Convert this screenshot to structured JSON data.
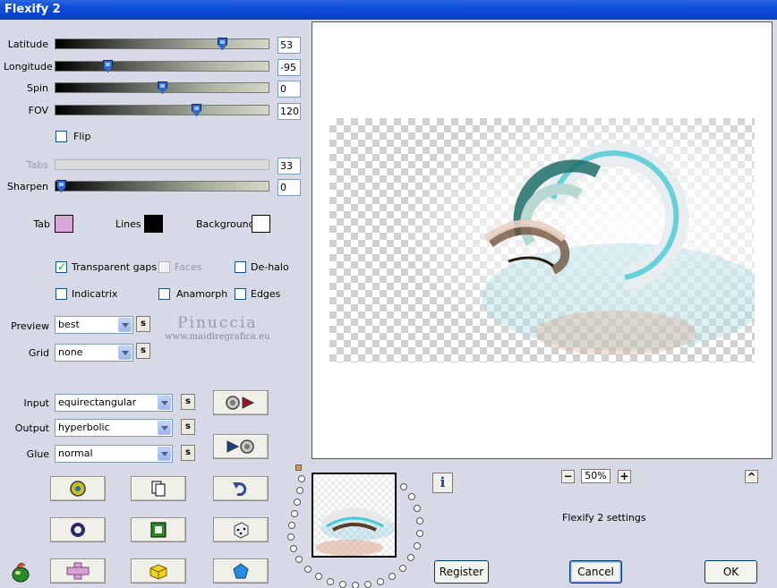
{
  "window": {
    "title": "Flexify 2"
  },
  "sliders": {
    "latitude": {
      "label": "Latitude",
      "value": "53",
      "position": 0.78
    },
    "longitude": {
      "label": "Longitude",
      "value": "-95",
      "position": 0.22
    },
    "spin": {
      "label": "Spin",
      "value": "0",
      "position": 0.5
    },
    "fov": {
      "label": "FOV",
      "value": "120",
      "position": 0.65
    },
    "tabs": {
      "label": "Tabs",
      "value": "33"
    },
    "sharpen": {
      "label": "Sharpen",
      "value": "0",
      "position": 0.0
    }
  },
  "flip": {
    "label": "Flip",
    "checked": false
  },
  "colors": {
    "tab": {
      "label": "Tab",
      "color": "#d8a6d8"
    },
    "lines": {
      "label": "Lines",
      "color": "#000000"
    },
    "background": {
      "label": "Background",
      "color": "#ffffff"
    }
  },
  "options": {
    "transparent_gaps": {
      "label": "Transparent gaps",
      "checked": true
    },
    "faces": {
      "label": "Faces",
      "checked": false
    },
    "de_halo": {
      "label": "De-halo",
      "checked": false
    },
    "indicatrix": {
      "label": "Indicatrix",
      "checked": false
    },
    "anamorph": {
      "label": "Anamorph",
      "checked": false
    },
    "edges": {
      "label": "Edges",
      "checked": false
    }
  },
  "dropdowns": {
    "preview": {
      "label": "Preview",
      "value": "best"
    },
    "grid": {
      "label": "Grid",
      "value": "none"
    },
    "input": {
      "label": "Input",
      "value": "equirectangular"
    },
    "output": {
      "label": "Output",
      "value": "hyperbolic"
    },
    "glue": {
      "label": "Glue",
      "value": "normal"
    }
  },
  "s_button_label": "s",
  "watermark": {
    "name": "Pinuccia",
    "url": "www.maidiregrafica.eu"
  },
  "zoom": {
    "value": "50%",
    "minus": "−",
    "plus": "+"
  },
  "scroll_up": "^",
  "info_label": "i",
  "status_text": "Flexify 2 settings",
  "buttons": {
    "register": "Register",
    "cancel": "Cancel",
    "ok": "OK"
  },
  "accent": {
    "title_bar": "#0a4ad8",
    "thumb": "#2f68c9",
    "check": "#21a121"
  }
}
